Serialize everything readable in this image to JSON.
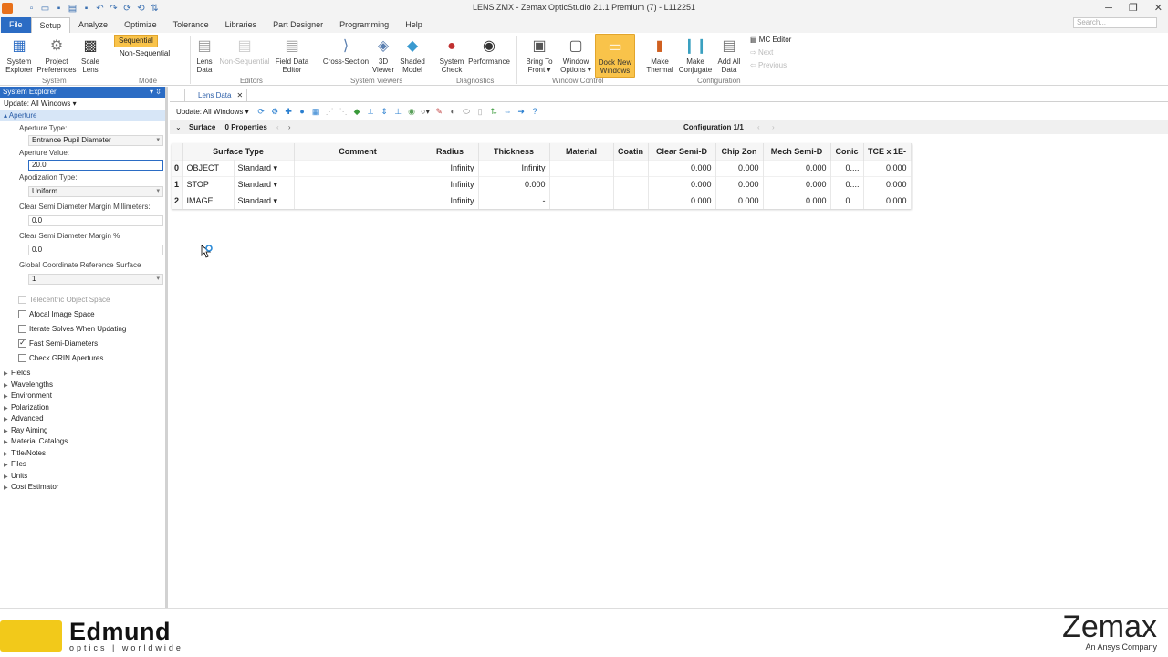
{
  "window": {
    "title": "LENS.ZMX - Zemax OpticStudio 21.1   Premium (7) - L112251",
    "search_placeholder": "Search..."
  },
  "window_controls": {
    "minimize": "─",
    "restore": "❐",
    "close": "✕"
  },
  "menu_tabs": [
    "File",
    "Setup",
    "Analyze",
    "Optimize",
    "Tolerance",
    "Libraries",
    "Part Designer",
    "Programming",
    "Help"
  ],
  "ribbon": {
    "system_explorer": "System\nExplorer",
    "project_preferences": "Project\nPreferences",
    "scale_lens": "Scale\nLens",
    "sequential": "Sequential",
    "non_sequential": "Non-Sequential",
    "lens_data": "Lens\nData",
    "non_sequential_editor": "Non-Sequential",
    "field_data_editor": "Field Data\nEditor",
    "cross_section": "Cross-Section",
    "viewer_3d": "3D\nViewer",
    "shaded_model": "Shaded\nModel",
    "system_check": "System\nCheck",
    "performance": "Performance",
    "bring_to_front": "Bring To\nFront ▾",
    "window_options": "Window\nOptions ▾",
    "dock_new_windows": "Dock New\nWindows",
    "make_thermal": "Make\nThermal",
    "make_conjugate": "Make\nConjugate",
    "add_all_data": "Add All\nData",
    "mc_editor": "MC Editor",
    "next": "Next",
    "previous": "Previous",
    "groups": {
      "system": "System",
      "mode": "Mode",
      "editors": "Editors",
      "system_viewers": "System Viewers",
      "diagnostics": "Diagnostics",
      "window_control": "Window Control",
      "configuration": "Configuration"
    }
  },
  "explorer": {
    "title": "System Explorer",
    "update": "Update: All Windows ▾",
    "aperture_section": "Aperture",
    "aperture_type_label": "Aperture Type:",
    "aperture_type_value": "Entrance Pupil Diameter",
    "aperture_value_label": "Aperture Value:",
    "aperture_value": "20.0",
    "apodization_label": "Apodization Type:",
    "apodization_value": "Uniform",
    "csd_margin_mm_label": "Clear Semi Diameter Margin Millimeters:",
    "csd_margin_mm_value": "0.0",
    "csd_margin_pct_label": "Clear Semi Diameter Margin %",
    "csd_margin_pct_value": "0.0",
    "global_ref_label": "Global Coordinate Reference Surface",
    "global_ref_value": "1",
    "telecentric": "Telecentric Object Space",
    "afocal": "Afocal Image Space",
    "iterate": "Iterate Solves When Updating",
    "fast_semi": "Fast Semi-Diameters",
    "check_grin": "Check GRIN Apertures",
    "tree": [
      "Fields",
      "Wavelengths",
      "Environment",
      "Polarization",
      "Advanced",
      "Ray Aiming",
      "Material Catalogs",
      "Title/Notes",
      "Files",
      "Units",
      "Cost Estimator"
    ]
  },
  "editor": {
    "tab_title": "Lens Data",
    "tab_close": "✕",
    "update": "Update: All Windows ▾",
    "surface_label": "Surface",
    "properties": "0 Properties",
    "configuration": "Configuration 1/1",
    "columns": [
      "Surface Type",
      "Comment",
      "Radius",
      "Thickness",
      "Material",
      "Coatin",
      "Clear Semi-D",
      "Chip Zon",
      "Mech Semi-D",
      "Conic",
      "TCE x 1E-"
    ],
    "rows": [
      {
        "idx": "0",
        "name": "OBJECT",
        "type": "Standard ▾",
        "comment": "",
        "radius": "Infinity",
        "thickness": "Infinity",
        "material": "",
        "coating": "",
        "clear": "0.000",
        "chip": "0.000",
        "mech": "0.000",
        "conic": "0....",
        "tce": "0.000"
      },
      {
        "idx": "1",
        "name": "STOP",
        "type": "Standard ▾",
        "comment": "",
        "radius": "Infinity",
        "thickness": "0.000",
        "material": "",
        "coating": "",
        "clear": "0.000",
        "chip": "0.000",
        "mech": "0.000",
        "conic": "0....",
        "tce": "0.000"
      },
      {
        "idx": "2",
        "name": "IMAGE",
        "type": "Standard ▾",
        "comment": "",
        "radius": "Infinity",
        "thickness": "-",
        "material": "",
        "coating": "",
        "clear": "0.000",
        "chip": "0.000",
        "mech": "0.000",
        "conic": "0....",
        "tce": "0.000"
      }
    ]
  },
  "footer": {
    "brand": "Edmund",
    "brand_sub": "optics | worldwide",
    "partner": "Zemax",
    "partner_sub": "An Ansys Company"
  },
  "colors": {
    "accent": "#2b6cc4",
    "highlight": "#f9c34a",
    "edmund_yellow": "#f2c91a"
  }
}
